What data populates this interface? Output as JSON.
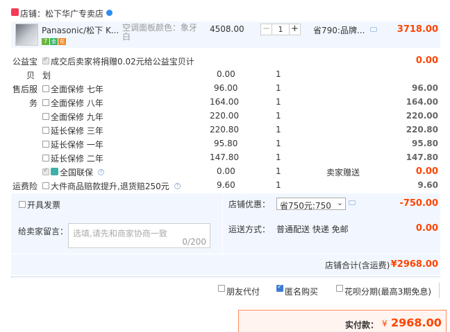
{
  "store": {
    "label": "店铺：",
    "name": "松下华广专卖店"
  },
  "product": {
    "title": "Panasonic/松下 K...",
    "attr": "空调面板颜色：象牙白",
    "price": "4508.00",
    "qty": "1",
    "saving": "省790:品牌...",
    "subtotal": "3718.00",
    "badges": [
      "7",
      "金",
      "花"
    ]
  },
  "services": [
    {
      "group": "公益宝贝",
      "label": "成交后卖家将捐赠0.02元给公益宝贝计划",
      "price": "",
      "qty": "",
      "note": "",
      "total": "0.00",
      "checked": true
    },
    {
      "group": "售后服务",
      "label": "全面保修 七年",
      "price": "96.00",
      "qty": "1",
      "note": "",
      "total": "96.00",
      "checked": false
    },
    {
      "group": "",
      "label": "全面保修 八年",
      "price": "164.00",
      "qty": "1",
      "note": "",
      "total": "164.00",
      "checked": false
    },
    {
      "group": "",
      "label": "全面保修 九年",
      "price": "220.00",
      "qty": "1",
      "note": "",
      "total": "220.00",
      "checked": false
    },
    {
      "group": "",
      "label": "延长保修 三年",
      "price": "220.80",
      "qty": "1",
      "note": "",
      "total": "220.80",
      "checked": false
    },
    {
      "group": "",
      "label": "延长保修 一年",
      "price": "95.80",
      "qty": "1",
      "note": "",
      "total": "95.80",
      "checked": false
    },
    {
      "group": "",
      "label": "延长保修 二年",
      "price": "147.80",
      "qty": "1",
      "note": "",
      "total": "147.80",
      "checked": false
    },
    {
      "group": "",
      "label": "全国联保",
      "price": "0.00",
      "qty": "1",
      "note": "卖家赠送",
      "total": "0.00",
      "checked": true
    },
    {
      "group": "运费险",
      "label": "大件商品赔款提升,退货赔250元",
      "price": "9.60",
      "qty": "1",
      "note": "",
      "total": "9.60",
      "checked": false
    }
  ],
  "public_benefit": {
    "group1": "公益宝",
    "group2": "贝",
    "line1": "成交后卖家将捐赠0.02元给公益宝贝计",
    "line2": "划",
    "price": "0.00",
    "qty": "1",
    "total": "0.00"
  },
  "aftersale_group": {
    "line1": "售后服",
    "line2": "务"
  },
  "invoice": {
    "label": "开具发票"
  },
  "discount": {
    "label": "店铺优惠：",
    "select": "省750元:750",
    "amount": "-750.00"
  },
  "message": {
    "label": "给卖家留言：",
    "placeholder": "选填,请先和商家协商一致",
    "counter": "0/200"
  },
  "shipping": {
    "label": "运送方式：",
    "value": "普通配送 快递 免邮",
    "amount": "0.00"
  },
  "store_total": {
    "label": "店铺合计(含运费)",
    "amount": "¥2968.00"
  },
  "options": {
    "friend_pay": "朋友代付",
    "anonymous": "匿名购买",
    "huabei": "花呗分期(最高3期免息)"
  },
  "pay": {
    "label": "实付款：",
    "currency": "¥",
    "amount": "2968.00"
  },
  "colors": {
    "accent": "#ff4400",
    "panel": "#f2f7ff",
    "brand_blue": "#3d7bd4"
  }
}
